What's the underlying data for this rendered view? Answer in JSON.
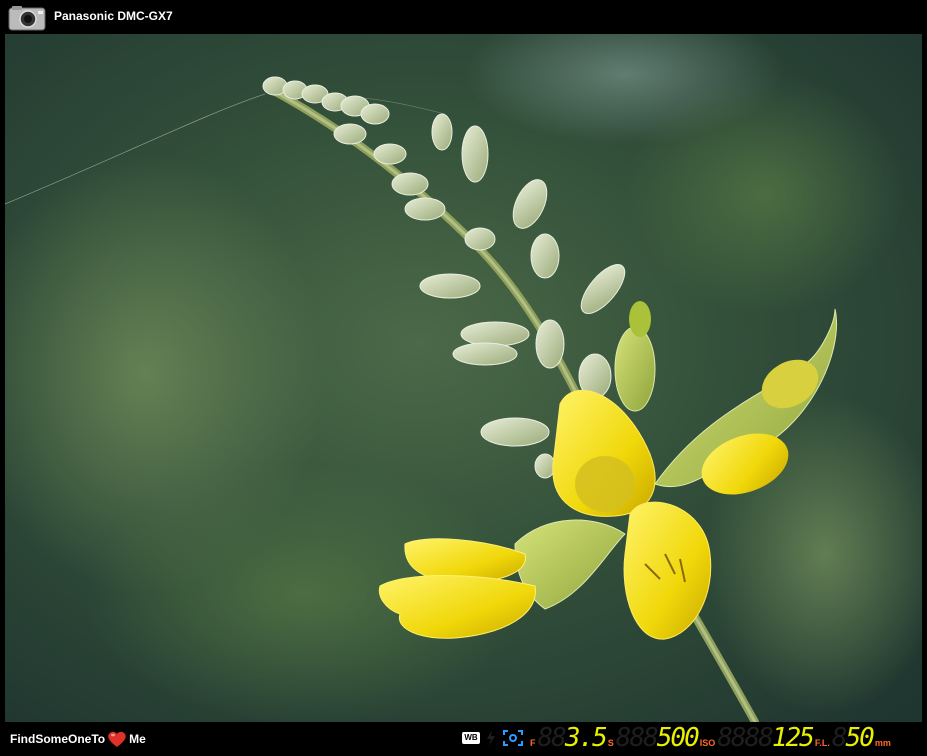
{
  "header": {
    "camera_model": "Panasonic DMC-GX7",
    "icon": "camera-icon"
  },
  "footer": {
    "brand_left": "FindSomeOneTo",
    "brand_right": "Me",
    "heart_icon": "heart-icon",
    "exif": {
      "wb_label": "WB",
      "aperture_label": "F",
      "aperture_value": "3.5",
      "aperture_ghost": "88",
      "shutter_label": "S",
      "shutter_value": "500",
      "shutter_ghost": "888",
      "iso_label": "ISO",
      "iso_value": "125",
      "iso_ghost": "8888",
      "focal_label": "F.L.",
      "focal_value": "50",
      "focal_ghost": "8",
      "focal_unit": "mm"
    }
  },
  "colors": {
    "lcd_value": "#e8f000",
    "label_orange": "#ff6a2a",
    "meter_blue": "#2a9cff",
    "flower_yellow": "#f0d80a",
    "background_green": "#3a5a3a"
  }
}
